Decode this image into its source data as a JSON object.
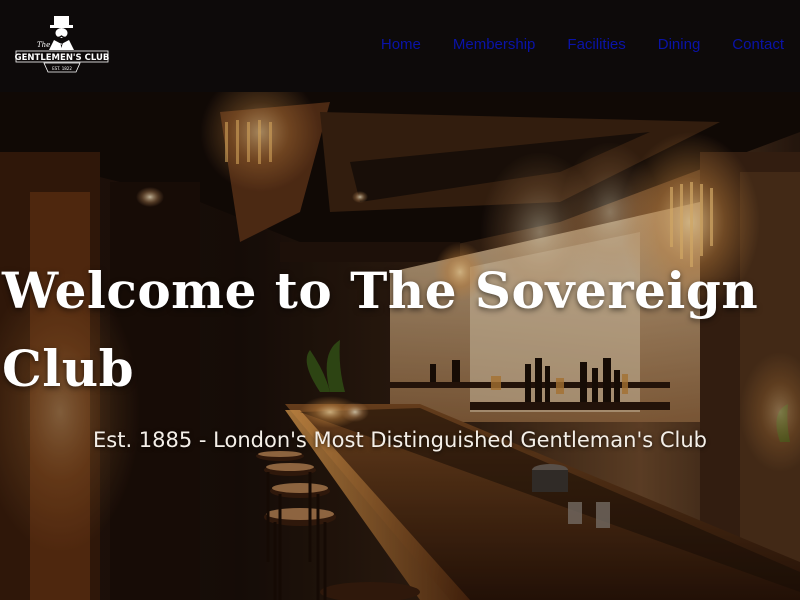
{
  "brand": {
    "logo_top": "The Real",
    "logo_main": "GENTLEMEN'S CLUB",
    "logo_est": "EST. 1822"
  },
  "nav": {
    "items": [
      {
        "label": "Home"
      },
      {
        "label": "Membership"
      },
      {
        "label": "Facilities"
      },
      {
        "label": "Dining"
      },
      {
        "label": "Contact"
      }
    ],
    "link_color": "#0a13a8"
  },
  "hero": {
    "title": "Welcome to The Sovereign Club",
    "subtitle": "Est. 1885 - London's Most Distinguished Gentleman's Club"
  },
  "colors": {
    "navbar_bg": "#0d0a0a",
    "hero_text": "#ffffff"
  }
}
